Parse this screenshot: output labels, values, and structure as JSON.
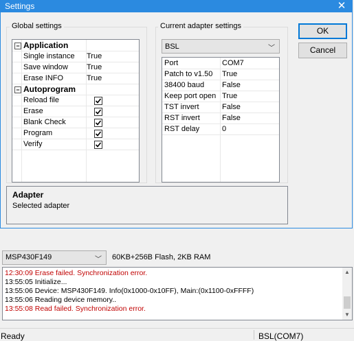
{
  "dialog": {
    "title": "Settings",
    "close_icon": "close-icon",
    "ok_label": "OK",
    "cancel_label": "Cancel"
  },
  "global": {
    "label": "Global settings",
    "categories": [
      {
        "name": "Application",
        "rows": [
          {
            "key": "Single instance",
            "value": "True"
          },
          {
            "key": "Save window",
            "value": "True"
          },
          {
            "key": "Erase INFO",
            "value": "True"
          }
        ]
      },
      {
        "name": "Autoprogram",
        "rows": [
          {
            "key": "Reload file",
            "checked": true
          },
          {
            "key": "Erase",
            "checked": true
          },
          {
            "key": "Blank Check",
            "checked": true
          },
          {
            "key": "Program",
            "checked": true
          },
          {
            "key": "Verify",
            "checked": true
          }
        ]
      }
    ]
  },
  "adapter": {
    "label": "Current adapter settings",
    "selected": "BSL",
    "rows": [
      {
        "key": "Port",
        "value": "COM7"
      },
      {
        "key": "Patch to v1.50",
        "value": "True"
      },
      {
        "key": "38400 baud",
        "value": "False"
      },
      {
        "key": "Keep port open",
        "value": "True"
      },
      {
        "key": "TST invert",
        "value": "False"
      },
      {
        "key": "RST invert",
        "value": "False"
      },
      {
        "key": "RST delay",
        "value": "0"
      }
    ]
  },
  "description": {
    "title": "Adapter",
    "text": "Selected adapter"
  },
  "main": {
    "device": "MSP430F149",
    "device_info": "60KB+256B Flash, 2KB RAM",
    "log": [
      {
        "text": "12:30:09  Erase failed. Synchronization error.",
        "error": true
      },
      {
        "text": "13:55:05  Initialize...",
        "error": false
      },
      {
        "text": "13:55:06  Device: MSP430F149. Info(0x1000-0x10FF), Main:(0x1100-0xFFFF)",
        "error": false
      },
      {
        "text": "13:55:06  Reading device memory..",
        "error": false
      },
      {
        "text": "13:55:08  Read failed. Synchronization error.",
        "error": true
      }
    ],
    "status_left": "Ready",
    "status_right": "BSL(COM7)"
  },
  "colors": {
    "title_bar": "#2b8ae0",
    "error_text": "#c00000",
    "default_button_border": "#0078d7"
  }
}
